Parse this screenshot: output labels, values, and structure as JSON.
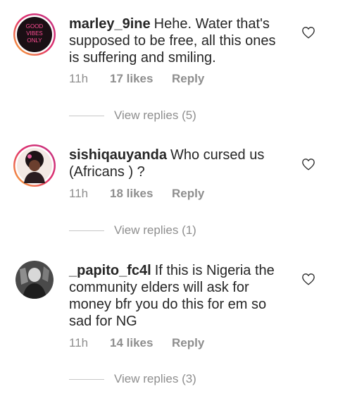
{
  "comments": [
    {
      "username": "marley_9ine",
      "text": "Hehe. Water that's supposed to be free, all this ones is suffering and smiling.",
      "time": "11h",
      "likes": "17 likes",
      "reply_label": "Reply",
      "view_replies": "View replies (5)",
      "avatar_text": [
        "GOOD",
        "VIBES",
        "ONLY"
      ]
    },
    {
      "username": "sishiqauyanda",
      "text": "Who cursed us (Africans ) ?",
      "time": "11h",
      "likes": "18 likes",
      "reply_label": "Reply",
      "view_replies": "View replies (1)"
    },
    {
      "username": "_papito_fc4l",
      "text": "If this is Nigeria the community elders will ask for money bfr you  do this for em  so sad for NG",
      "time": "11h",
      "likes": "14 likes",
      "reply_label": "Reply",
      "view_replies": "View replies (3)"
    }
  ],
  "colors": {
    "text": "#262626",
    "muted": "#8e8e8e",
    "avatar_ring_start": "#f9b233",
    "avatar_ring_end": "#c13584",
    "neon_pink": "#ff3d8b"
  },
  "icons": {
    "like": "heart-outline-icon"
  }
}
